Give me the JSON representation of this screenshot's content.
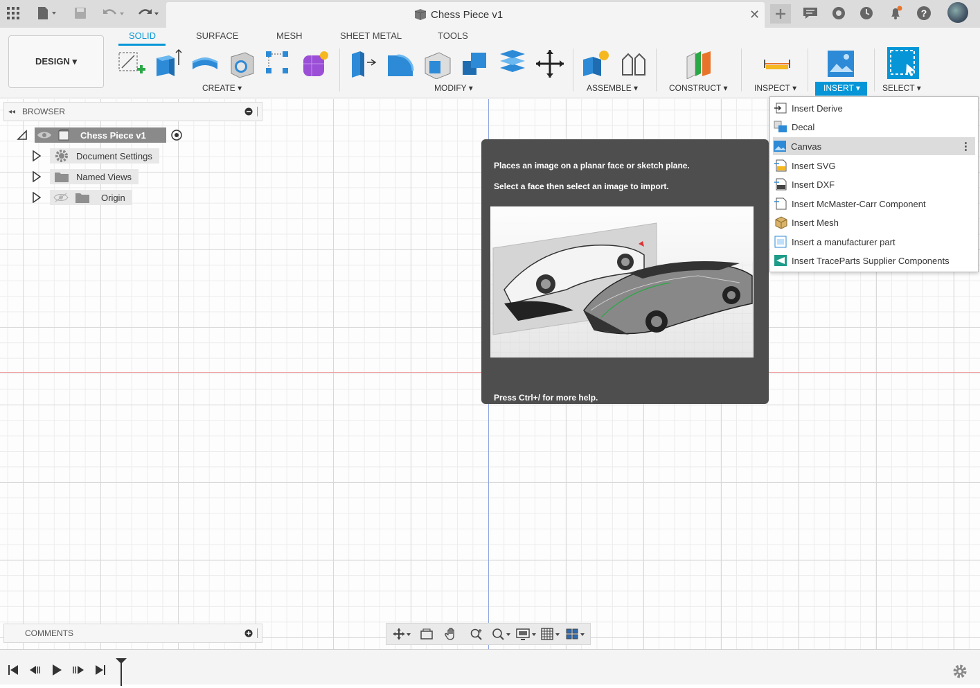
{
  "window": {
    "title": "Chess Piece v1"
  },
  "toolbar_tabs": [
    {
      "label": "SOLID"
    },
    {
      "label": "SURFACE"
    },
    {
      "label": "MESH"
    },
    {
      "label": "SHEET METAL"
    },
    {
      "label": "TOOLS"
    }
  ],
  "workspace": {
    "label": "DESIGN ▾"
  },
  "groups": {
    "create": "CREATE ▾",
    "modify": "MODIFY ▾",
    "assemble": "ASSEMBLE ▾",
    "construct": "CONSTRUCT ▾",
    "inspect": "INSPECT ▾",
    "insert": "INSERT ▾",
    "select": "SELECT ▾"
  },
  "browser": {
    "title": "BROWSER",
    "root": "Chess Piece v1",
    "items": [
      {
        "label": "Document Settings"
      },
      {
        "label": "Named Views"
      },
      {
        "label": "Origin"
      }
    ]
  },
  "comments": {
    "title": "COMMENTS"
  },
  "tooltip": {
    "line1": "Places an image on a planar face or sketch plane.",
    "line2": "Select a face then select an image to import.",
    "help": "Press Ctrl+/ for more help."
  },
  "insert_menu": {
    "items": [
      {
        "label": "Insert Derive"
      },
      {
        "label": "Decal"
      },
      {
        "label": "Canvas"
      },
      {
        "label": "Insert SVG"
      },
      {
        "label": "Insert DXF"
      },
      {
        "label": "Insert McMaster-Carr Component"
      },
      {
        "label": "Insert Mesh"
      },
      {
        "label": "Insert a manufacturer part"
      },
      {
        "label": "Insert TraceParts Supplier Components"
      }
    ],
    "highlighted_index": 2
  },
  "colors": {
    "accent": "#0696d7",
    "tooltip_bg": "#4e4e4e"
  }
}
